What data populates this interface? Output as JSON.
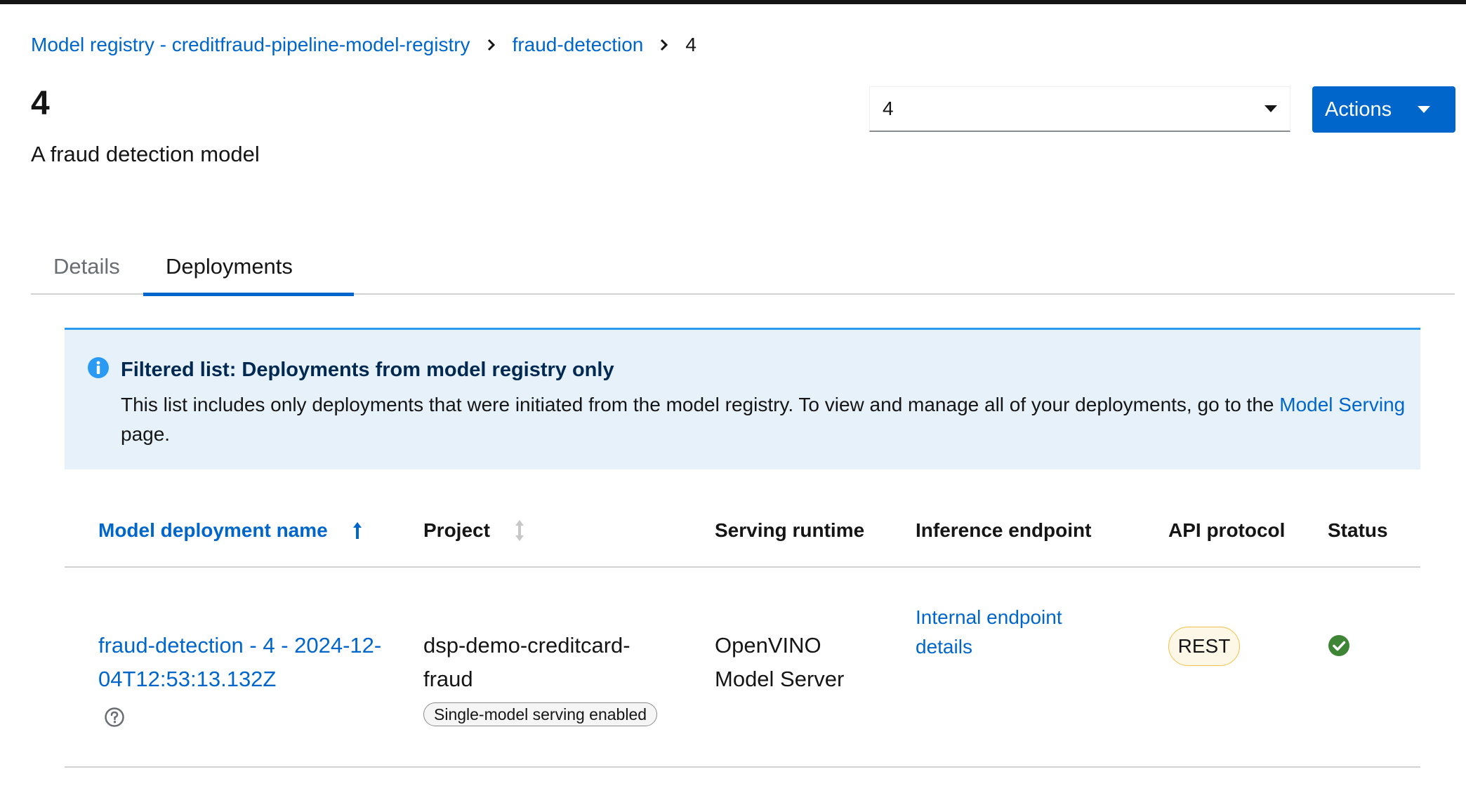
{
  "breadcrumb": {
    "registry": "Model registry - creditfraud-pipeline-model-registry",
    "model": "fraud-detection",
    "version": "4"
  },
  "header": {
    "title": "4",
    "description": "A fraud detection model",
    "version_select_value": "4",
    "actions_label": "Actions"
  },
  "tabs": [
    {
      "label": "Details",
      "selected": false
    },
    {
      "label": "Deployments",
      "selected": true
    }
  ],
  "alert": {
    "icon": "info-circle-icon",
    "title": "Filtered list: Deployments from model registry only",
    "body_prefix": "This list includes only deployments that were initiated from the model registry. To view and manage all of your deployments, go to the ",
    "body_link": "Model Serving",
    "body_suffix": " page."
  },
  "table": {
    "columns": [
      {
        "label": "Model deployment name",
        "sort": "ascending"
      },
      {
        "label": "Project",
        "sort": "unsorted"
      },
      {
        "label": "Serving runtime"
      },
      {
        "label": "Inference endpoint"
      },
      {
        "label": "API protocol"
      },
      {
        "label": "Status"
      }
    ],
    "rows": [
      {
        "name": "fraud-detection - 4 - 2024-12-04T12:53:13.132Z",
        "project": "dsp-demo-creditcard-fraud",
        "project_badge": "Single-model serving enabled",
        "runtime": "OpenVINO Model Server",
        "endpoint": "Internal endpoint details",
        "protocol": "REST",
        "status_icon": "check-circle-icon",
        "status_color": "#3e8635"
      }
    ]
  },
  "colors": {
    "primary": "#0066cc",
    "alert_background": "#e7f1fa",
    "success": "#3e8635"
  }
}
